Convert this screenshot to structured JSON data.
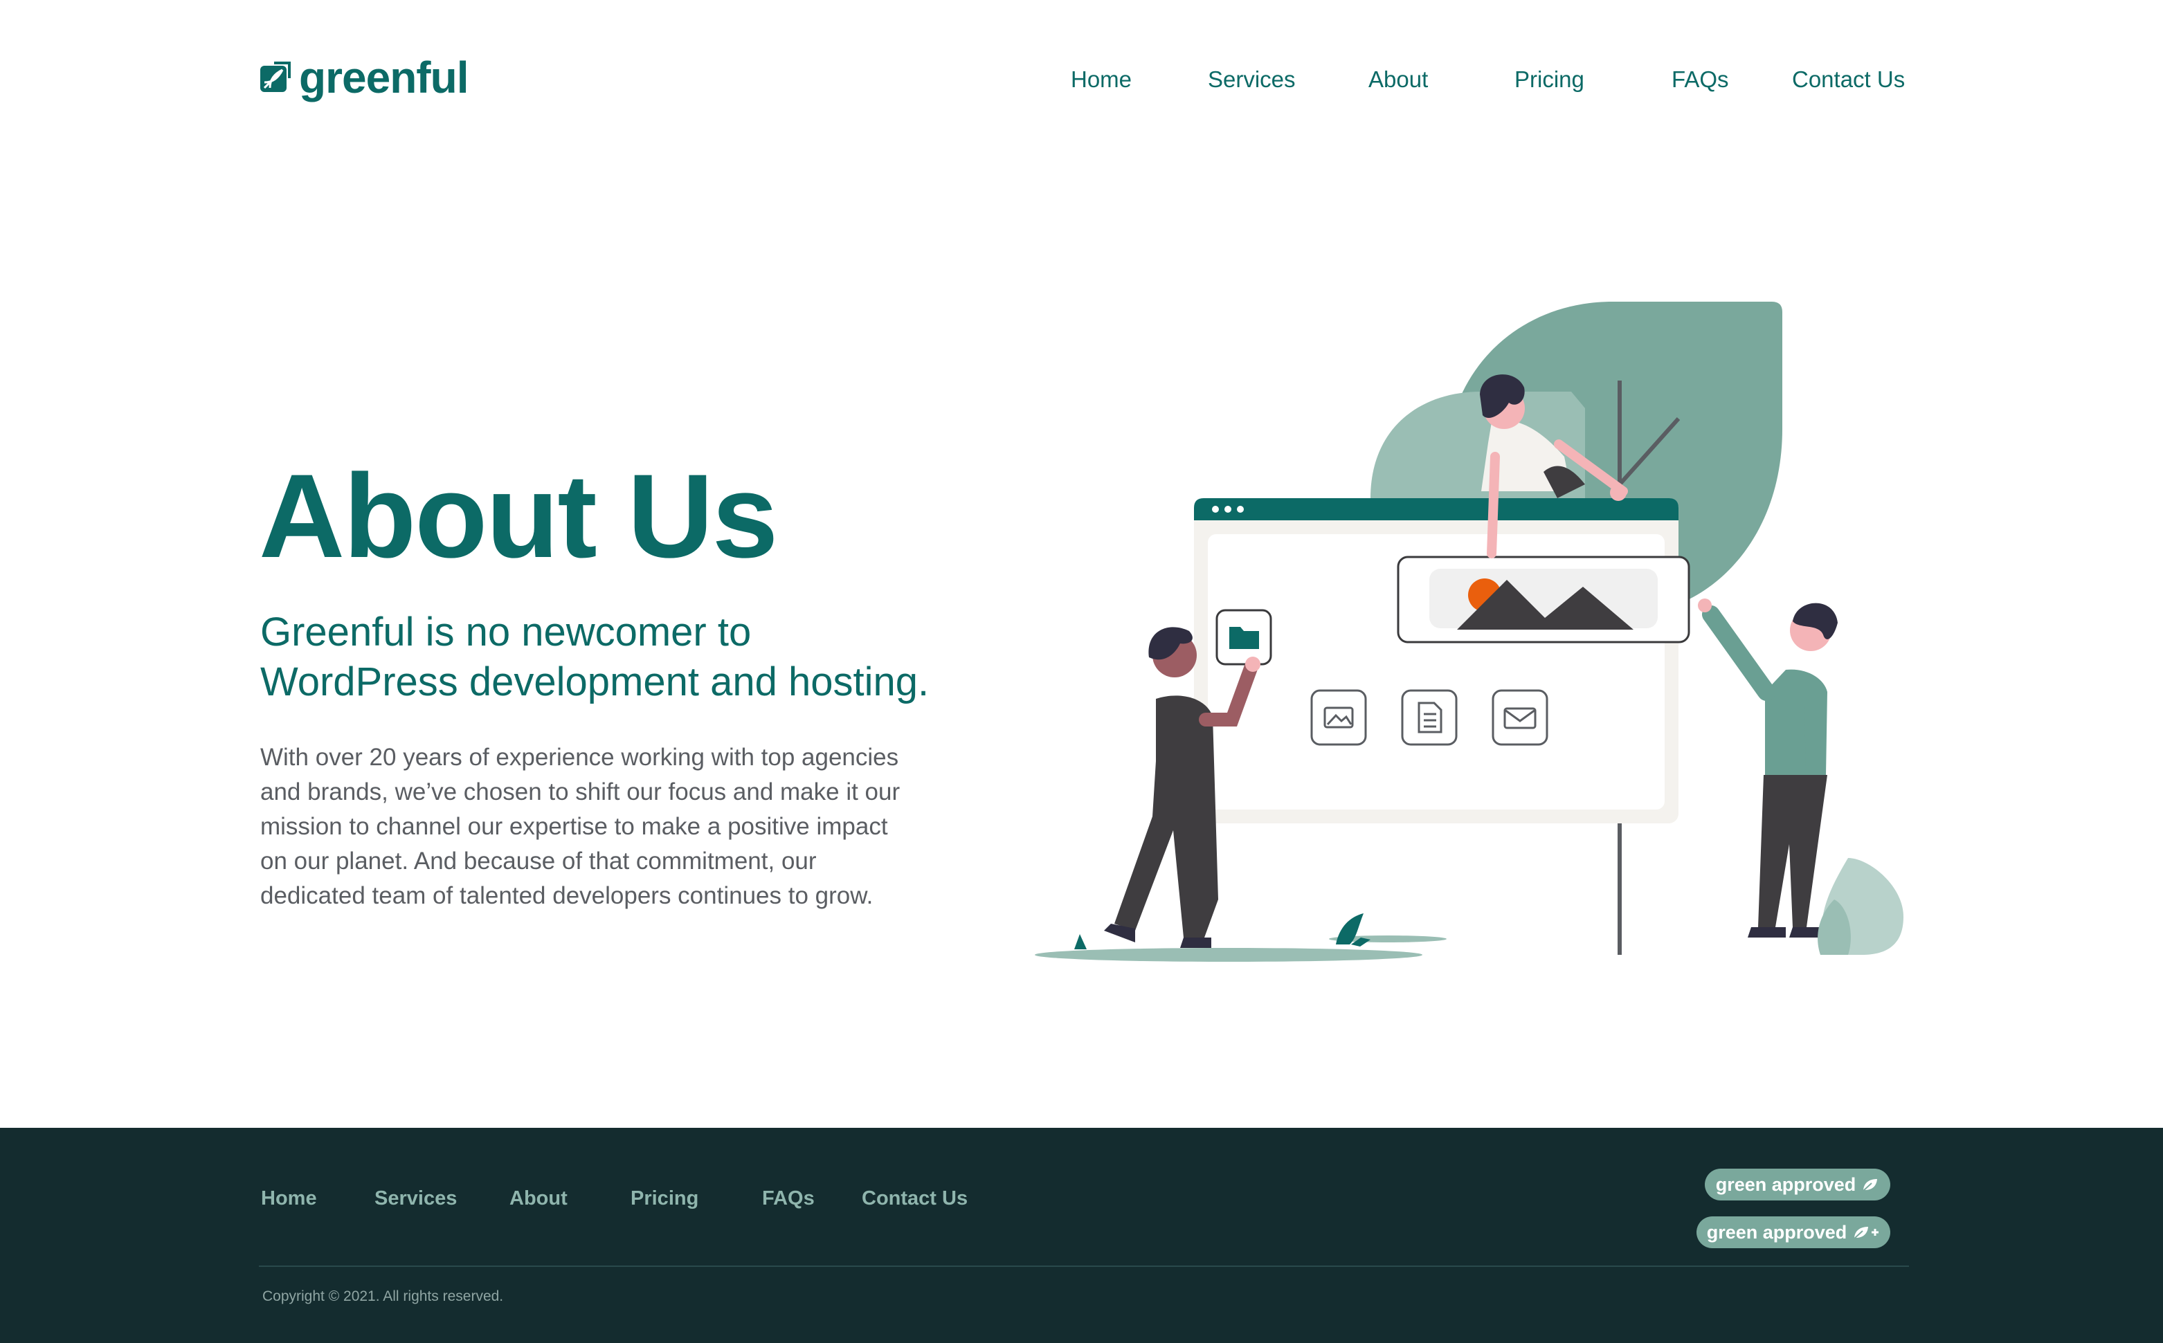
{
  "brand": {
    "name": "greenful",
    "logo_icon": "leaf-box-icon"
  },
  "colors": {
    "primary": "#0c6a66",
    "footer_bg": "#142c2f",
    "badge_bg": "#7aa89c",
    "accent_orange": "#ea5f0d"
  },
  "nav": {
    "items": [
      {
        "label": "Home"
      },
      {
        "label": "Services"
      },
      {
        "label": "About"
      },
      {
        "label": "Pricing"
      },
      {
        "label": "FAQs"
      },
      {
        "label": "Contact Us"
      }
    ]
  },
  "hero": {
    "title": "About Us",
    "subtitle_lines": [
      "Greenful is no newcomer to",
      "WordPress development and hosting."
    ],
    "body_lines": [
      "With over 20 years of experience working with top agencies",
      "and brands, we’ve chosen to shift our focus and make it our",
      "mission to channel our expertise to make a positive impact",
      "on our planet. And because of that commitment, our",
      "dedicated team of talented developers continues to grow."
    ]
  },
  "illustration": {
    "icons": [
      "folder-icon",
      "image-icon",
      "document-icon",
      "mail-icon",
      "mountain-photo-icon"
    ]
  },
  "footer": {
    "nav": [
      {
        "label": "Home"
      },
      {
        "label": "Services"
      },
      {
        "label": "About"
      },
      {
        "label": "Pricing"
      },
      {
        "label": "FAQs"
      },
      {
        "label": "Contact Us"
      }
    ],
    "badges": [
      {
        "label": "green approved",
        "icon": "leaf-icon"
      },
      {
        "label": "green approved",
        "icon": "leaf-plus-icon"
      }
    ],
    "copyright": "Copyright © 2021. All rights reserved."
  }
}
